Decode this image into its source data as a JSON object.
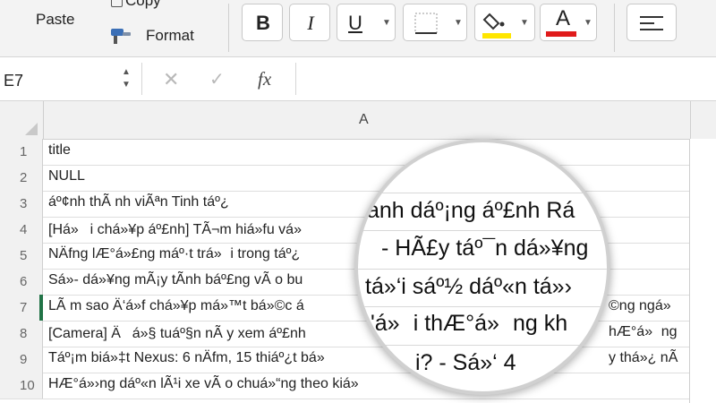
{
  "ribbon": {
    "paste_label": "Paste",
    "copy_label": "Copy",
    "format_label": "Format",
    "bold_label": "B",
    "italic_label": "I",
    "underline_label": "U",
    "font_color_label": "A",
    "fill_color": "#ffe600",
    "font_color": "#e01b1b"
  },
  "formula_bar": {
    "name_box": "E7",
    "fx_label": "fx",
    "formula_value": ""
  },
  "sheet": {
    "column_header": "A",
    "rows": [
      {
        "num": "1",
        "value": "title"
      },
      {
        "num": "2",
        "value": "NULL"
      },
      {
        "num": "3",
        "value": "áº¢nh thÃ nh viÃªn Tinh táº¿"
      },
      {
        "num": "4",
        "value": "[Há»i chá»¥p áº£nh] TÃ¬m hiá»fu vá»"
      },
      {
        "num": "5",
        "value": "NÄfng lÆ°á»£ng máº·t trá»i trong táº¿"
      },
      {
        "num": "6",
        "value": "Sá»- dá»¥ng mÃ¡y tÃ­nh báº£ng vÃ o bu"
      },
      {
        "num": "7",
        "value": "LÃ m sao Ä‘á»f chá»¥p má»™t bá»©c á"
      },
      {
        "num": "8",
        "value": "[Camera] Äá»§ tuáº§n nÃ y xem áº£nh"
      },
      {
        "num": "9",
        "value": "Táº¡m biá»‡t Nexus: 6 nÄfm, 15 thiáº¿t bá»"
      },
      {
        "num": "10",
        "value": "HÆ°á»›ng dáº«n lÃ¹i xe vÃ o chuá»“ng theo kiá»"
      }
    ],
    "row7_tail": "©ng ngá»",
    "row8_tail": "hÆ°á»ng",
    "row10_tail": "y thá»¿ nÃ"
  },
  "magnifier": {
    "line1": "ảnh dáº¡ng áº£nh Rá",
    "line2": "- HÃ£y táº¯n dá»¥ng",
    "line3": "tá»‘i sáº½ dáº«n tá»›",
    "line4": "'á»i thÆ°á»ng kh",
    "line5": "i? - Sá»‘ 4"
  }
}
